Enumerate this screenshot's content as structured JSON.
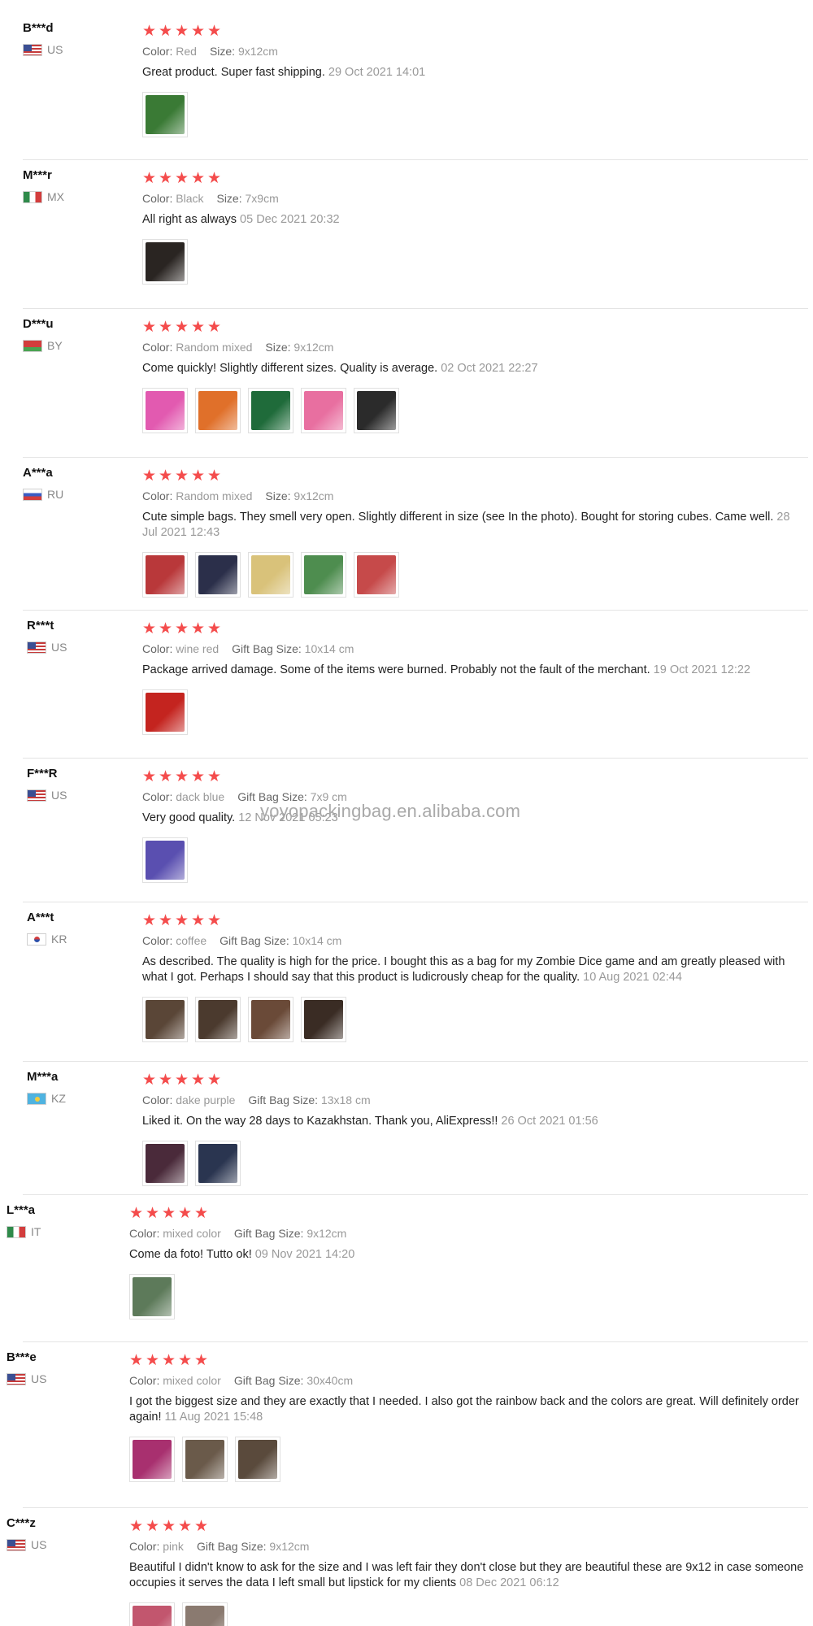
{
  "watermark": "yoyopackingbag.en.alibaba.com",
  "colors": {
    "star": "#f44c4c",
    "meta_label": "#666666",
    "meta_value": "#999999",
    "date": "#999999",
    "text": "#222222"
  },
  "star_icon": "★",
  "reviews": [
    {
      "user": "B***d",
      "country": "US",
      "flag": "us",
      "stars": 5,
      "meta": [
        {
          "label": "Color:",
          "value": "Red"
        },
        {
          "label": "Size:",
          "value": "9x12cm"
        }
      ],
      "text": "Great product. Super fast shipping.",
      "date": "29 Oct 2021 14:01",
      "thumbs": [
        "#3a7a35"
      ]
    },
    {
      "user": "M***r",
      "country": "MX",
      "flag": "mx",
      "stars": 5,
      "meta": [
        {
          "label": "Color:",
          "value": "Black"
        },
        {
          "label": "Size:",
          "value": "7x9cm"
        }
      ],
      "text": "All right as always",
      "date": "05 Dec 2021 20:32",
      "thumbs": [
        "#2a2522"
      ]
    },
    {
      "user": "D***u",
      "country": "BY",
      "flag": "by",
      "stars": 5,
      "meta": [
        {
          "label": "Color:",
          "value": "Random mixed"
        },
        {
          "label": "Size:",
          "value": "9x12cm"
        }
      ],
      "text": "Come quickly! Slightly different sizes. Quality is average.",
      "date": "02 Oct 2021 22:27",
      "thumbs": [
        "#e25ab0",
        "#e0702a",
        "#1f6b3a",
        "#e86fa0",
        "#2b2b2b"
      ]
    },
    {
      "user": "A***a",
      "country": "RU",
      "flag": "ru",
      "stars": 5,
      "meta": [
        {
          "label": "Color:",
          "value": "Random mixed"
        },
        {
          "label": "Size:",
          "value": "9x12cm"
        }
      ],
      "text": "Cute simple bags. They smell very open. Slightly different in size (see In the photo). Bought for storing cubes. Came well.",
      "date": "28 Jul 2021 12:43",
      "thumbs": [
        "#b9383a",
        "#2b2f4a",
        "#d9c27a",
        "#4e8d4f",
        "#c64a4a"
      ]
    },
    {
      "user": "R***t",
      "country": "US",
      "flag": "us",
      "stars": 5,
      "meta": [
        {
          "label": "Color:",
          "value": "wine red"
        },
        {
          "label": "Gift Bag Size:",
          "value": "10x14 cm"
        }
      ],
      "text": "Package arrived damage. Some of the items were burned. Probably not the fault of the merchant.",
      "date": "19 Oct 2021 12:22",
      "thumbs": [
        "#c4241f"
      ]
    },
    {
      "user": "F***R",
      "country": "US",
      "flag": "us",
      "stars": 5,
      "meta": [
        {
          "label": "Color:",
          "value": "dack blue"
        },
        {
          "label": "Gift Bag Size:",
          "value": "7x9 cm"
        }
      ],
      "text": "Very good quality.",
      "date": "12 Nov 2021 05:23",
      "thumbs": [
        "#5a4fb0"
      ]
    },
    {
      "user": "A***t",
      "country": "KR",
      "flag": "kr",
      "stars": 5,
      "meta": [
        {
          "label": "Color:",
          "value": "coffee"
        },
        {
          "label": "Gift Bag Size:",
          "value": "10x14 cm"
        }
      ],
      "text": "As described. The quality is high for the price. I bought this as a bag for my Zombie Dice game and am greatly pleased with what I got. Perhaps I should say that this product is ludicrously cheap for the quality.",
      "date": "10 Aug 2021 02:44",
      "thumbs": [
        "#5a4637",
        "#4b3a2e",
        "#6a4a38",
        "#3a2c24"
      ]
    },
    {
      "user": "M***a",
      "country": "KZ",
      "flag": "kz",
      "stars": 5,
      "meta": [
        {
          "label": "Color:",
          "value": "dake purple"
        },
        {
          "label": "Gift Bag Size:",
          "value": "13x18 cm"
        }
      ],
      "text": "Liked it. On the way 28 days to Kazakhstan. Thank you, AliExpress!!",
      "date": "26 Oct 2021 01:56",
      "thumbs": [
        "#4a2a3a",
        "#2a3550"
      ]
    },
    {
      "user": "L***a",
      "country": "IT",
      "flag": "it",
      "stars": 5,
      "meta": [
        {
          "label": "Color:",
          "value": "mixed color"
        },
        {
          "label": "Gift Bag Size:",
          "value": "9x12cm"
        }
      ],
      "text": "Come da foto! Tutto ok!",
      "date": "09 Nov 2021 14:20",
      "thumbs": [
        "#5d7a5a"
      ]
    },
    {
      "user": "B***e",
      "country": "US",
      "flag": "us",
      "stars": 5,
      "meta": [
        {
          "label": "Color:",
          "value": "mixed color"
        },
        {
          "label": "Gift Bag Size:",
          "value": "30x40cm"
        }
      ],
      "text": "I got the biggest size and they are exactly that I needed. I also got the rainbow back and the colors are great. Will definitely order again!",
      "date": "11 Aug 2021 15:48",
      "thumbs": [
        "#a8306f",
        "#6a5a4a",
        "#5a4a3c"
      ]
    },
    {
      "user": "C***z",
      "country": "US",
      "flag": "us",
      "stars": 5,
      "meta": [
        {
          "label": "Color:",
          "value": "pink"
        },
        {
          "label": "Gift Bag Size:",
          "value": "9x12cm"
        }
      ],
      "text": "Beautiful I didn't know to ask for the size and I was left fair they don't close but they are beautiful these are 9x12 in case someone occupies it serves the data I left small but lipstick for my clients",
      "date": "08 Dec 2021 06:12",
      "thumbs": [
        "#c2566e",
        "#8a7a70"
      ]
    }
  ]
}
